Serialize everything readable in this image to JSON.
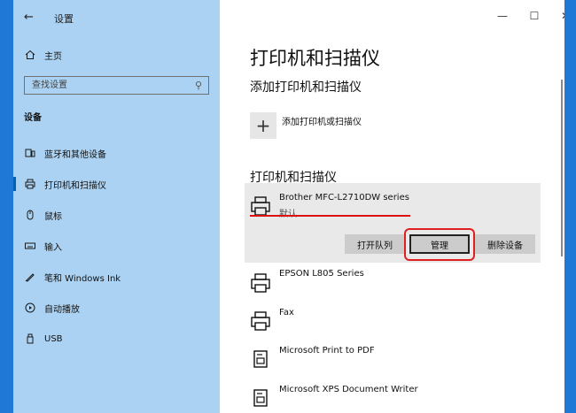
{
  "titlebar": {
    "title": "设置",
    "minimize": "—",
    "maximize": "☐",
    "close": "✕"
  },
  "sidebar": {
    "home_label": "主页",
    "search_placeholder": "查找设置",
    "section": "设备",
    "items": [
      {
        "label": "蓝牙和其他设备",
        "icon": "bluetooth-devices-icon"
      },
      {
        "label": "打印机和扫描仪",
        "icon": "printer-icon",
        "selected": true
      },
      {
        "label": "鼠标",
        "icon": "mouse-icon"
      },
      {
        "label": "输入",
        "icon": "keyboard-icon"
      },
      {
        "label": "笔和 Windows Ink",
        "icon": "pen-icon"
      },
      {
        "label": "自动播放",
        "icon": "autoplay-icon"
      },
      {
        "label": "USB",
        "icon": "usb-icon"
      }
    ]
  },
  "main": {
    "title": "打印机和扫描仪",
    "add_section_title": "添加打印机和扫描仪",
    "add_label": "添加打印机或扫描仪",
    "list_title": "打印机和扫描仪",
    "printers": [
      {
        "name": "Brother MFC-L2710DW series",
        "status": "默认"
      },
      {
        "name": "EPSON L805 Series"
      },
      {
        "name": "Fax"
      },
      {
        "name": "Microsoft Print to PDF"
      },
      {
        "name": "Microsoft XPS Document Writer"
      }
    ],
    "actions": {
      "open_queue": "打开队列",
      "manage": "管理",
      "remove": "删除设备"
    }
  },
  "colors": {
    "sidebar_bg": "#abd2f2",
    "accent": "#0063b1",
    "highlight": "#e02020"
  }
}
